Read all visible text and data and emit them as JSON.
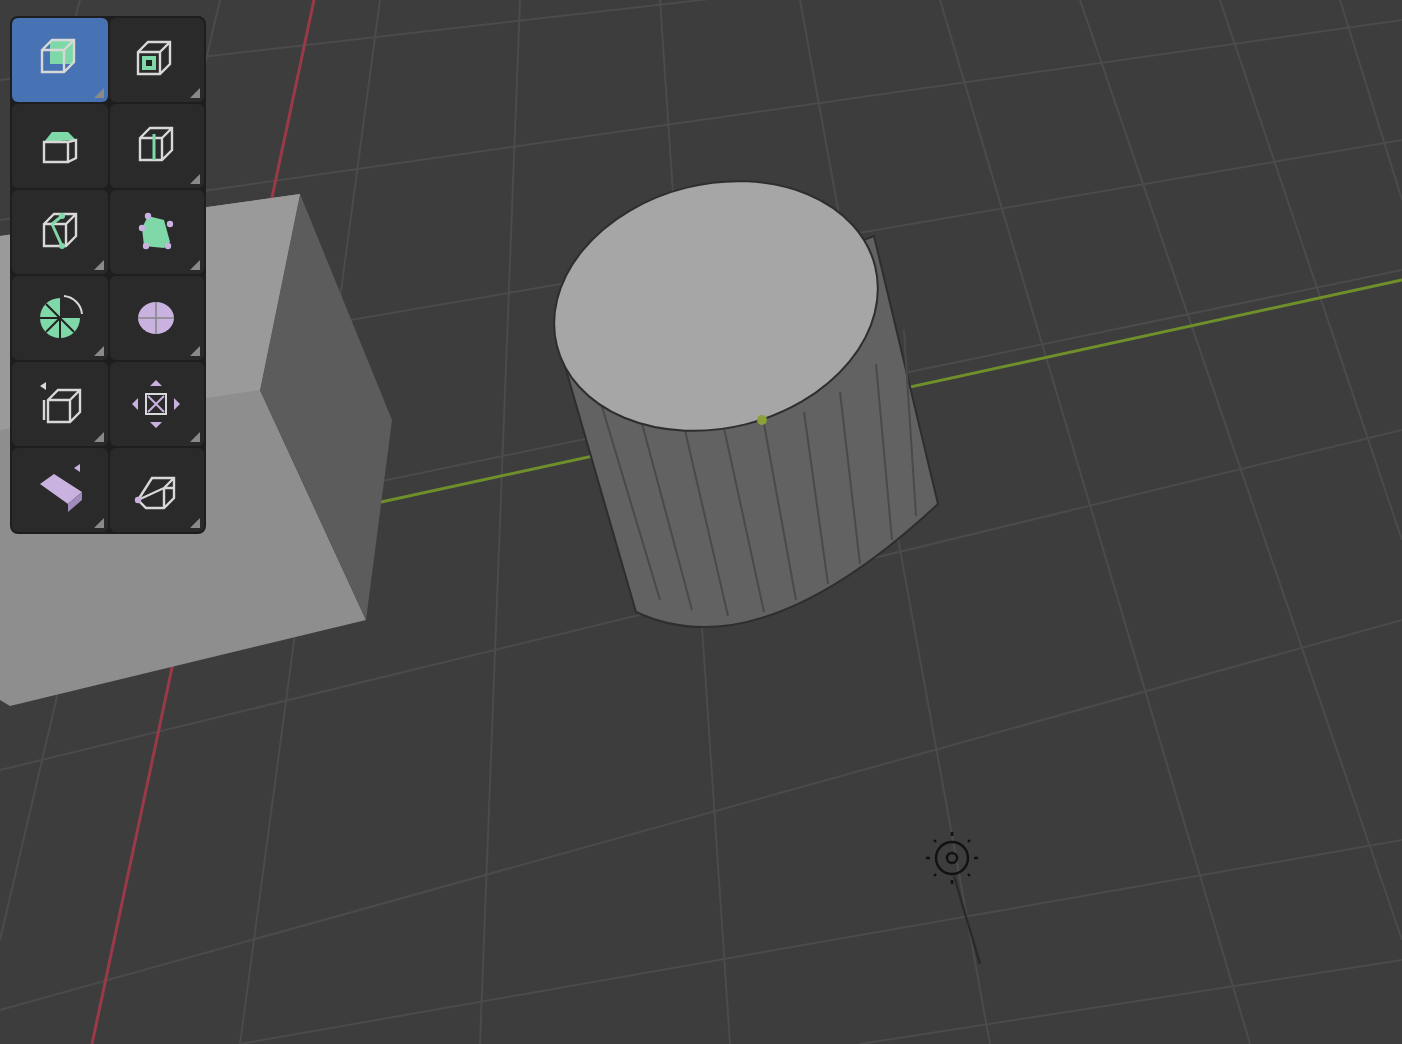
{
  "toolbar": {
    "tools": [
      {
        "kind": "extrude",
        "selected": true,
        "has_submenu": true
      },
      {
        "kind": "inset",
        "selected": false,
        "has_submenu": true
      },
      {
        "kind": "bevel",
        "selected": false,
        "has_submenu": false
      },
      {
        "kind": "loopcut",
        "selected": false,
        "has_submenu": true
      },
      {
        "kind": "knife",
        "selected": false,
        "has_submenu": true
      },
      {
        "kind": "polybuild",
        "selected": false,
        "has_submenu": true
      },
      {
        "kind": "spin",
        "selected": false,
        "has_submenu": true
      },
      {
        "kind": "smooth",
        "selected": false,
        "has_submenu": true
      },
      {
        "kind": "slide",
        "selected": false,
        "has_submenu": true
      },
      {
        "kind": "shrink",
        "selected": false,
        "has_submenu": true
      },
      {
        "kind": "shear",
        "selected": false,
        "has_submenu": true
      },
      {
        "kind": "rip",
        "selected": false,
        "has_submenu": true
      }
    ]
  }
}
